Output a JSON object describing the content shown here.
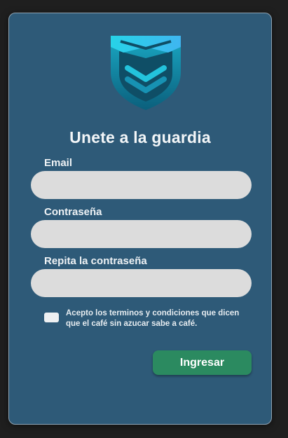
{
  "form": {
    "title": "Unete a la guardia",
    "fields": [
      {
        "label": "Email",
        "value": "",
        "placeholder": ""
      },
      {
        "label": "Contraseña",
        "value": "",
        "placeholder": ""
      },
      {
        "label": "Repita la contraseña",
        "value": "",
        "placeholder": ""
      }
    ],
    "terms": {
      "checked": false,
      "text": "Acepto los terminos y condiciones que dicen que el café sin azucar sabe a café."
    },
    "submit_label": "Ingresar"
  },
  "logo": {
    "icon": "shield-check-icon"
  },
  "colors": {
    "page_background": "#1f1f1f",
    "card_background": "#2e5a78",
    "input_background": "#dcdcdc",
    "button_background": "#2b8a60",
    "logo_gradient": [
      "#19c6dc",
      "#0d6f8c"
    ]
  }
}
